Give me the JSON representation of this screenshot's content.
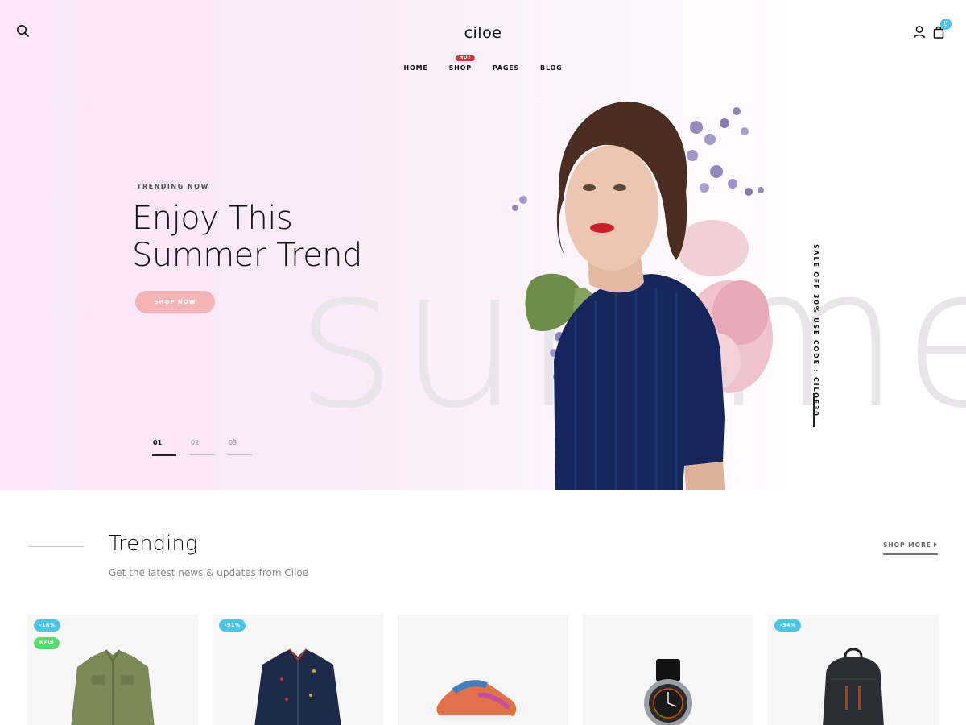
{
  "brand": {
    "logo": "ciloe"
  },
  "header": {
    "icons": [
      "search-icon",
      "user-icon",
      "shopping-bag-icon"
    ],
    "cart_count": "0"
  },
  "nav": {
    "items": [
      {
        "label": "HOME"
      },
      {
        "label": "SHOP",
        "badge": "HOT"
      },
      {
        "label": "PAGES"
      },
      {
        "label": "BLOG"
      }
    ]
  },
  "hero": {
    "eyebrow": "TRENDING NOW",
    "headline_line1": "Enjoy This",
    "headline_line2": "Summer Trend",
    "cta": "SHOP NOW",
    "background_word": "summer",
    "side_promo": "SALE OFF 30% USE CODE : CILOE30",
    "pager": [
      "01",
      "02",
      "03"
    ],
    "active_slide": "01"
  },
  "trending": {
    "title": "Trending",
    "subtitle": "Get the latest news & updates from Ciloe",
    "shop_more": "SHOP MORE",
    "products": [
      {
        "name": "olive-jacket",
        "badges": [
          "-16%",
          "NEW"
        ]
      },
      {
        "name": "navy-jacket",
        "badges": [
          "-91%"
        ]
      },
      {
        "name": "floral-sneaker",
        "badges": []
      },
      {
        "name": "wrist-watch",
        "badges": []
      },
      {
        "name": "backpack",
        "badges": [
          "-34%"
        ]
      }
    ]
  },
  "colors": {
    "accent": "#4ec4e0",
    "hot": "#e6323c",
    "new": "#5bd96e",
    "cta": "#f2b4b6"
  }
}
